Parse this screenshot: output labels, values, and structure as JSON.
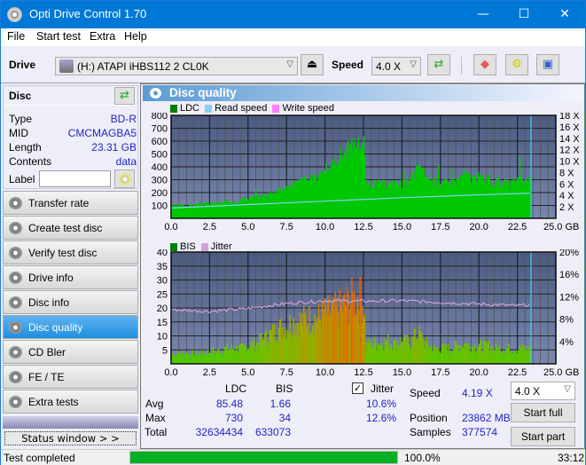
{
  "window": {
    "title": "Opti Drive Control 1.70",
    "minimize": "—",
    "maximize": "☐",
    "close": "✕"
  },
  "menu": [
    "File",
    "Start test",
    "Extra",
    "Help"
  ],
  "toolbar": {
    "drive_label": "Drive",
    "drive_value": "(H:)  ATAPI iHBS112  2 CL0K",
    "speed_label": "Speed",
    "speed_value": "4.0 X"
  },
  "disc": {
    "header": "Disc",
    "rows": [
      {
        "label": "Type",
        "value": "BD-R"
      },
      {
        "label": "MID",
        "value": "CMCMAGBA5"
      },
      {
        "label": "Length",
        "value": "23.31 GB"
      },
      {
        "label": "Contents",
        "value": "data"
      }
    ],
    "label_field": "Label",
    "label_value": ""
  },
  "nav": [
    {
      "label": "Transfer rate",
      "active": false
    },
    {
      "label": "Create test disc",
      "active": false
    },
    {
      "label": "Verify test disc",
      "active": false
    },
    {
      "label": "Drive info",
      "active": false
    },
    {
      "label": "Disc info",
      "active": false
    },
    {
      "label": "Disc quality",
      "active": true
    },
    {
      "label": "CD Bler",
      "active": false
    },
    {
      "label": "FE / TE",
      "active": false
    },
    {
      "label": "Extra tests",
      "active": false
    }
  ],
  "status_window_button": "Status window > >",
  "panel_title": "Disc quality",
  "chart_data": [
    {
      "type": "area",
      "title": "LDC",
      "legend": [
        {
          "name": "LDC",
          "color": "#008000"
        },
        {
          "name": "Read speed",
          "color": "#87cefa"
        },
        {
          "name": "Write speed",
          "color": "#ff80ff"
        }
      ],
      "xlabel": "GB",
      "xlim": [
        0,
        25
      ],
      "x_ticks": [
        "0.0",
        "2.5",
        "5.0",
        "7.5",
        "10.0",
        "12.5",
        "15.0",
        "17.5",
        "20.0",
        "22.5",
        "25.0 GB"
      ],
      "ylim": [
        0,
        800
      ],
      "y_ticks": [
        "100",
        "200",
        "300",
        "400",
        "500",
        "600",
        "700",
        "800"
      ],
      "y2_ticks": [
        "2 X",
        "4 X",
        "6 X",
        "8 X",
        "10 X",
        "12 X",
        "14 X",
        "16 X",
        "18 X"
      ],
      "y2lim": [
        0,
        18
      ],
      "ldc_x": [
        0,
        0.5,
        1,
        1.5,
        2,
        2.5,
        3,
        3.5,
        4,
        4.5,
        5,
        5.5,
        6,
        6.5,
        7,
        7.5,
        8,
        8.5,
        9,
        9.5,
        10,
        10.5,
        11,
        11.5,
        12,
        12.5,
        12.6,
        13,
        13.5,
        14,
        14.5,
        15,
        15.5,
        16,
        16.5,
        17,
        17.5,
        18,
        18.5,
        19,
        19.5,
        20,
        20.5,
        21,
        21.5,
        22,
        22.5,
        23,
        23.3
      ],
      "ldc_y": [
        90,
        95,
        100,
        105,
        110,
        115,
        120,
        125,
        130,
        140,
        150,
        165,
        180,
        200,
        220,
        240,
        270,
        290,
        300,
        320,
        380,
        400,
        500,
        540,
        570,
        590,
        250,
        260,
        270,
        260,
        270,
        270,
        280,
        400,
        330,
        280,
        270,
        270,
        290,
        350,
        300,
        320,
        300,
        280,
        270,
        260,
        280,
        290,
        290
      ],
      "read_speed_x": [
        0,
        5,
        10,
        15,
        20,
        23.3
      ],
      "read_speed_y": [
        1.8,
        2.4,
        3.0,
        3.6,
        4.1,
        4.4
      ]
    },
    {
      "type": "bar",
      "title": "BIS",
      "legend": [
        {
          "name": "BIS",
          "color": "#008000"
        },
        {
          "name": "Jitter",
          "color": "#d8a0d8"
        }
      ],
      "xlabel": "GB",
      "xlim": [
        0,
        25
      ],
      "x_ticks": [
        "0.0",
        "2.5",
        "5.0",
        "7.5",
        "10.0",
        "12.5",
        "15.0",
        "17.5",
        "20.0",
        "22.5",
        "25.0 GB"
      ],
      "ylim": [
        0,
        40
      ],
      "y_ticks": [
        "5",
        "10",
        "15",
        "20",
        "25",
        "30",
        "35",
        "40"
      ],
      "y2_ticks": [
        "4%",
        "8%",
        "12%",
        "16%",
        "20%"
      ],
      "y2lim": [
        0,
        20
      ],
      "bis_x": [
        0,
        0.5,
        1,
        1.5,
        2,
        2.5,
        3,
        3.5,
        4,
        4.5,
        5,
        5.5,
        6,
        6.5,
        7,
        7.5,
        8,
        8.5,
        9,
        9.5,
        10,
        10.5,
        11,
        11.5,
        12,
        12.5,
        12.6,
        13,
        13.5,
        14,
        14.5,
        15,
        15.5,
        16,
        16.5,
        17,
        17.5,
        18,
        18.5,
        19,
        19.5,
        20,
        20.5,
        21,
        21.5,
        22,
        22.5,
        23,
        23.3
      ],
      "bis_y": [
        4,
        4,
        4,
        4,
        4,
        5,
        5,
        6,
        6,
        6,
        7,
        8,
        10,
        12,
        14,
        15,
        17,
        17,
        18,
        18,
        20,
        20,
        22,
        24,
        26,
        25,
        7,
        8,
        8,
        9,
        8,
        9,
        8,
        12,
        8,
        6,
        6,
        6,
        7,
        8,
        7,
        7,
        7,
        6,
        6,
        6,
        6,
        6,
        6
      ],
      "jitter_x": [
        0,
        2.5,
        5,
        7.5,
        10,
        12.5,
        15,
        17.5,
        20,
        22.5,
        23.3
      ],
      "jitter_y": [
        9.7,
        9.4,
        9.9,
        10.8,
        11.3,
        11.2,
        11.3,
        11.0,
        10.7,
        10.4,
        10.6
      ]
    }
  ],
  "stats": {
    "col_ldc": "LDC",
    "col_bis": "BIS",
    "jitter_label": "Jitter",
    "jitter_checked": true,
    "rows": [
      {
        "label": "Avg",
        "ldc": "85.48",
        "bis": "1.66",
        "jitter": "10.6%"
      },
      {
        "label": "Max",
        "ldc": "730",
        "bis": "34",
        "jitter": "12.6%"
      },
      {
        "label": "Total",
        "ldc": "32634434",
        "bis": "633073",
        "jitter": ""
      }
    ],
    "speed_label": "Speed",
    "speed_value": "4.19 X",
    "position_label": "Position",
    "position_value": "23862 MB",
    "samples_label": "Samples",
    "samples_value": "377574",
    "speed_select": "4.0 X",
    "start_full": "Start full",
    "start_part": "Start part"
  },
  "statusbar": {
    "text": "Test completed",
    "progress": 100.0,
    "progress_text": "100.0%",
    "time": "33:12"
  }
}
